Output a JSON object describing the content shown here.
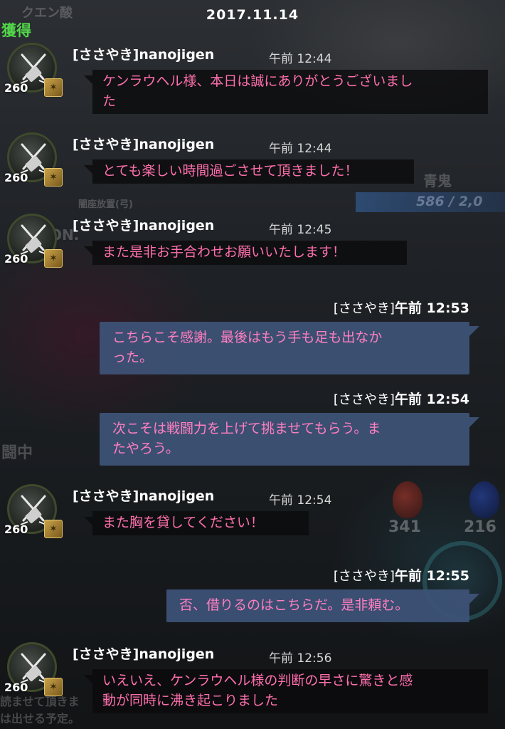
{
  "header": {
    "date": "2017.11.14",
    "acquired_label": "獲得"
  },
  "background": {
    "labels": [
      "クエン酸",
      "青鬼",
      "586 / 2,0",
      "闘中",
      "341",
      "216",
      "闇座放置(弓)",
      "ON.",
      "は出せる予定。",
      "読ませて頂きま"
    ]
  },
  "avatar": {
    "level": "260",
    "icon": "crossed-weapons-icon",
    "badge_icon": "guild-badge-icon"
  },
  "colors": {
    "incoming_text": "#ff6fae",
    "outgoing_text": "#ff7fc0",
    "outgoing_bubble": "#3e5478",
    "acquired": "#52d84a"
  },
  "messages": [
    {
      "dir": "in",
      "sender": "[ささやき]nanojigen",
      "time": "午前 12:44",
      "lines": [
        "ケンラウヘル様、本日は誠にありがとうございまし",
        "た"
      ]
    },
    {
      "dir": "in",
      "sender": "[ささやき]nanojigen",
      "time": "午前 12:44",
      "lines": [
        "とても楽しい時間過ごさせて頂きました！"
      ]
    },
    {
      "dir": "in",
      "sender": "[ささやき]nanojigen",
      "time": "午前 12:45",
      "lines": [
        "また是非お手合わせお願いいたします！"
      ]
    },
    {
      "dir": "out",
      "whisper": "[ささやき]",
      "time": "午前 12:53",
      "lines": [
        "こちらこそ感謝。最後はもう手も足も出なか",
        "った。"
      ]
    },
    {
      "dir": "out",
      "whisper": "[ささやき]",
      "time": "午前 12:54",
      "lines": [
        "次こそは戦闘力を上げて挑ませてもらう。ま",
        "たやろう。"
      ]
    },
    {
      "dir": "in",
      "sender": "[ささやき]nanojigen",
      "time": "午前 12:54",
      "lines": [
        "また胸を貸してください！"
      ]
    },
    {
      "dir": "out",
      "whisper": "[ささやき]",
      "time": "午前 12:55",
      "lines": [
        "否、借りるのはこちらだ。是非頼む。"
      ]
    },
    {
      "dir": "in",
      "sender": "[ささやき]nanojigen",
      "time": "午前 12:56",
      "lines": [
        "いえいえ、ケンラウヘル様の判断の早さに驚きと感",
        "動が同時に沸き起こりました"
      ]
    }
  ]
}
